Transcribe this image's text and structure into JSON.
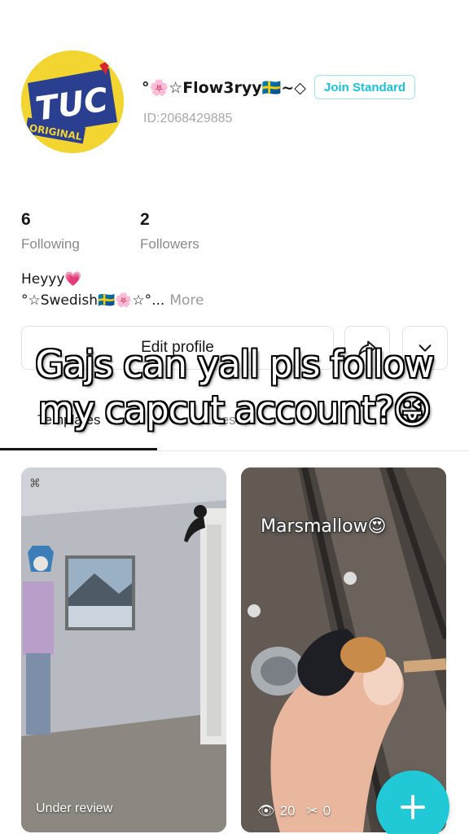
{
  "profile": {
    "username": "°🌸☆Flow3ryy🇸🇪~◇",
    "join_label": "Join Standard",
    "user_id": "ID:2068429885",
    "avatar_text": "TUC",
    "avatar_subtext": "ORIGINAL"
  },
  "stats": [
    {
      "value": "6",
      "label": "Following"
    },
    {
      "value": "2",
      "label": "Followers"
    }
  ],
  "bio": {
    "line1": "Heyyy💗",
    "line2": "°☆Swedish🇸🇪🌸☆°...",
    "more_label": "More"
  },
  "actions": {
    "edit_profile_label": "Edit profile",
    "share_icon": "share-icon",
    "dropdown_icon": "chevron-down-icon"
  },
  "tabs": [
    "Templates",
    "Likes"
  ],
  "overlay": {
    "line1": "Gajs can yall pls follow",
    "line2": "my capcut account?😜"
  },
  "videos": [
    {
      "caption": "Under review"
    },
    {
      "label": "Marsmallow😍",
      "views": "20",
      "uses": "0"
    }
  ],
  "colors": {
    "accent": "#21c8d6",
    "join_border": "#9ee6ef",
    "muted_text": "#8a8a8a"
  }
}
